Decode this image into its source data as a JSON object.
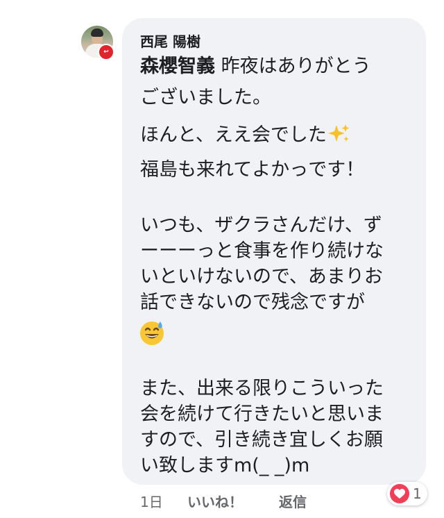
{
  "comment": {
    "author": "西尾 陽樹",
    "mention": "森櫻智義",
    "lines": [
      " 昨夜はありがとう",
      "ございました。",
      "ほんと、ええ会でした",
      "福島も来れてよかっです！",
      "いつも、ザクラさんだけ、ず",
      "ーーーっと食事を作り続けな",
      "いといけないので、あまりお",
      "話できないので残念ですが",
      "また、出来る限りこういった",
      "会を続けて行きたいと思いま",
      "すので、引き続き宜しくお願",
      "い致しますm(_ _)m"
    ],
    "emojis": [
      "sparkles",
      "grinning-face-with-sweat"
    ]
  },
  "footer": {
    "time": "1日",
    "like_label": "いいね！",
    "reply_label": "返信"
  },
  "reaction": {
    "type": "love",
    "count": "1",
    "color": "#f33e58"
  },
  "colors": {
    "bubble": "#f0f2f5",
    "text": "#1c1e21",
    "meta": "#65676b"
  }
}
